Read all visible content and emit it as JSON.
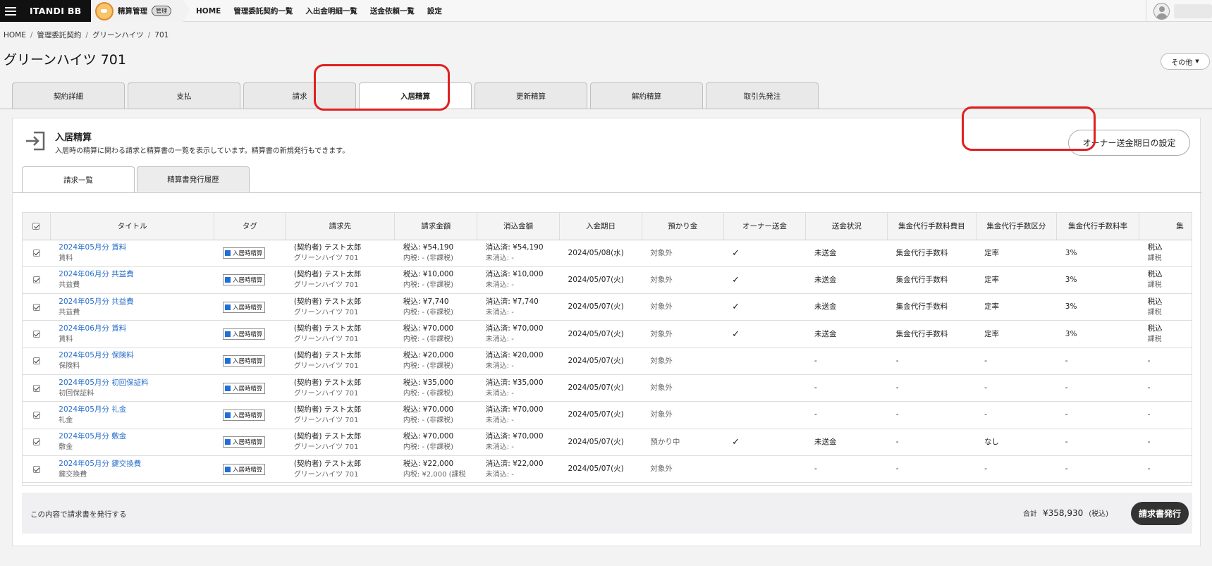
{
  "topbar": {
    "brand": "ITANDI BB",
    "app_name": "精算管理",
    "admin_badge": "管理",
    "nav": [
      "HOME",
      "管理委託契約一覧",
      "入出金明細一覧",
      "送金依頼一覧",
      "設定"
    ]
  },
  "breadcrumb": [
    "HOME",
    "管理委託契約",
    "グリーンハイツ",
    "701"
  ],
  "page_title": "グリーンハイツ 701",
  "other_button": "その他",
  "tabs": [
    "契約詳細",
    "支払",
    "請求",
    "入居精算",
    "更新精算",
    "解約精算",
    "取引先発注"
  ],
  "active_tab": "入居精算",
  "section": {
    "title": "入居精算",
    "description": "入居時の精算に関わる請求と精算書の一覧を表示しています。精算書の新規発行もできます。",
    "owner_button": "オーナー送金期日の設定"
  },
  "subtabs": [
    "請求一覧",
    "精算書発行履歴"
  ],
  "table": {
    "headers": [
      "タイトル",
      "タグ",
      "請求先",
      "請求金額",
      "消込金額",
      "入金期日",
      "預かり金",
      "オーナー送金",
      "送金状況",
      "集金代行手数料費目",
      "集金代行手数区分",
      "集金代行手数料率",
      "集"
    ],
    "rows": [
      {
        "title": "2024年05月分 賃料",
        "sub": "賃料",
        "tag": "入居時精算",
        "payer": "(契約者) テスト太郎",
        "payer2": "グリーンハイツ 701",
        "amount": "税込: ¥54,190",
        "amount2": "内税: - (非課税)",
        "cleared": "消込済: ¥54,190",
        "cleared2": "未消込: -",
        "due": "2024/05/08(水)",
        "deposit": "対象外",
        "owner": "✓",
        "status": "未送金",
        "fee_item": "集金代行手数料",
        "fee_type": "定率",
        "fee_rate": "3%",
        "extra": "税込",
        "extra2": "課税"
      },
      {
        "title": "2024年06月分 共益費",
        "sub": "共益費",
        "tag": "入居時精算",
        "payer": "(契約者) テスト太郎",
        "payer2": "グリーンハイツ 701",
        "amount": "税込: ¥10,000",
        "amount2": "内税: - (非課税)",
        "cleared": "消込済: ¥10,000",
        "cleared2": "未消込: -",
        "due": "2024/05/07(火)",
        "deposit": "対象外",
        "owner": "✓",
        "status": "未送金",
        "fee_item": "集金代行手数料",
        "fee_type": "定率",
        "fee_rate": "3%",
        "extra": "税込",
        "extra2": "課税"
      },
      {
        "title": "2024年05月分 共益費",
        "sub": "共益費",
        "tag": "入居時精算",
        "payer": "(契約者) テスト太郎",
        "payer2": "グリーンハイツ 701",
        "amount": "税込: ¥7,740",
        "amount2": "内税: - (非課税)",
        "cleared": "消込済: ¥7,740",
        "cleared2": "未消込: -",
        "due": "2024/05/07(火)",
        "deposit": "対象外",
        "owner": "✓",
        "status": "未送金",
        "fee_item": "集金代行手数料",
        "fee_type": "定率",
        "fee_rate": "3%",
        "extra": "税込",
        "extra2": "課税"
      },
      {
        "title": "2024年06月分 賃料",
        "sub": "賃料",
        "tag": "入居時精算",
        "payer": "(契約者) テスト太郎",
        "payer2": "グリーンハイツ 701",
        "amount": "税込: ¥70,000",
        "amount2": "内税: - (非課税)",
        "cleared": "消込済: ¥70,000",
        "cleared2": "未消込: -",
        "due": "2024/05/07(火)",
        "deposit": "対象外",
        "owner": "✓",
        "status": "未送金",
        "fee_item": "集金代行手数料",
        "fee_type": "定率",
        "fee_rate": "3%",
        "extra": "税込",
        "extra2": "課税"
      },
      {
        "title": "2024年05月分 保険料",
        "sub": "保険料",
        "tag": "入居時精算",
        "payer": "(契約者) テスト太郎",
        "payer2": "グリーンハイツ 701",
        "amount": "税込: ¥20,000",
        "amount2": "内税: - (非課税)",
        "cleared": "消込済: ¥20,000",
        "cleared2": "未消込: -",
        "due": "2024/05/07(火)",
        "deposit": "対象外",
        "owner": "",
        "status": "-",
        "fee_item": "-",
        "fee_type": "-",
        "fee_rate": "-",
        "extra": "-",
        "extra2": ""
      },
      {
        "title": "2024年05月分 初回保証料",
        "sub": "初回保証料",
        "tag": "入居時精算",
        "payer": "(契約者) テスト太郎",
        "payer2": "グリーンハイツ 701",
        "amount": "税込: ¥35,000",
        "amount2": "内税: - (非課税)",
        "cleared": "消込済: ¥35,000",
        "cleared2": "未消込: -",
        "due": "2024/05/07(火)",
        "deposit": "対象外",
        "owner": "",
        "status": "-",
        "fee_item": "-",
        "fee_type": "-",
        "fee_rate": "-",
        "extra": "-",
        "extra2": ""
      },
      {
        "title": "2024年05月分 礼金",
        "sub": "礼金",
        "tag": "入居時精算",
        "payer": "(契約者) テスト太郎",
        "payer2": "グリーンハイツ 701",
        "amount": "税込: ¥70,000",
        "amount2": "内税: - (非課税)",
        "cleared": "消込済: ¥70,000",
        "cleared2": "未消込: -",
        "due": "2024/05/07(火)",
        "deposit": "対象外",
        "owner": "",
        "status": "-",
        "fee_item": "-",
        "fee_type": "-",
        "fee_rate": "-",
        "extra": "-",
        "extra2": ""
      },
      {
        "title": "2024年05月分 敷金",
        "sub": "敷金",
        "tag": "入居時精算",
        "payer": "(契約者) テスト太郎",
        "payer2": "グリーンハイツ 701",
        "amount": "税込: ¥70,000",
        "amount2": "内税: - (非課税)",
        "cleared": "消込済: ¥70,000",
        "cleared2": "未消込: -",
        "due": "2024/05/07(火)",
        "deposit": "預かり中",
        "owner": "✓",
        "status": "未送金",
        "fee_item": "-",
        "fee_type": "なし",
        "fee_rate": "-",
        "extra": "-",
        "extra2": ""
      },
      {
        "title": "2024年05月分 鍵交換費",
        "sub": "鍵交換費",
        "tag": "入居時精算",
        "payer": "(契約者) テスト太郎",
        "payer2": "グリーンハイツ 701",
        "amount": "税込: ¥22,000",
        "amount2": "内税: ¥2,000 (課税",
        "cleared": "消込済: ¥22,000",
        "cleared2": "未消込: -",
        "due": "2024/05/07(火)",
        "deposit": "対象外",
        "owner": "",
        "status": "-",
        "fee_item": "-",
        "fee_type": "-",
        "fee_rate": "-",
        "extra": "-",
        "extra2": ""
      }
    ]
  },
  "footer": {
    "text": "この内容で請求書を発行する",
    "total_label": "合計",
    "total": "¥358,930",
    "tax_note": "(税込)",
    "issue_button": "請求書発行"
  }
}
